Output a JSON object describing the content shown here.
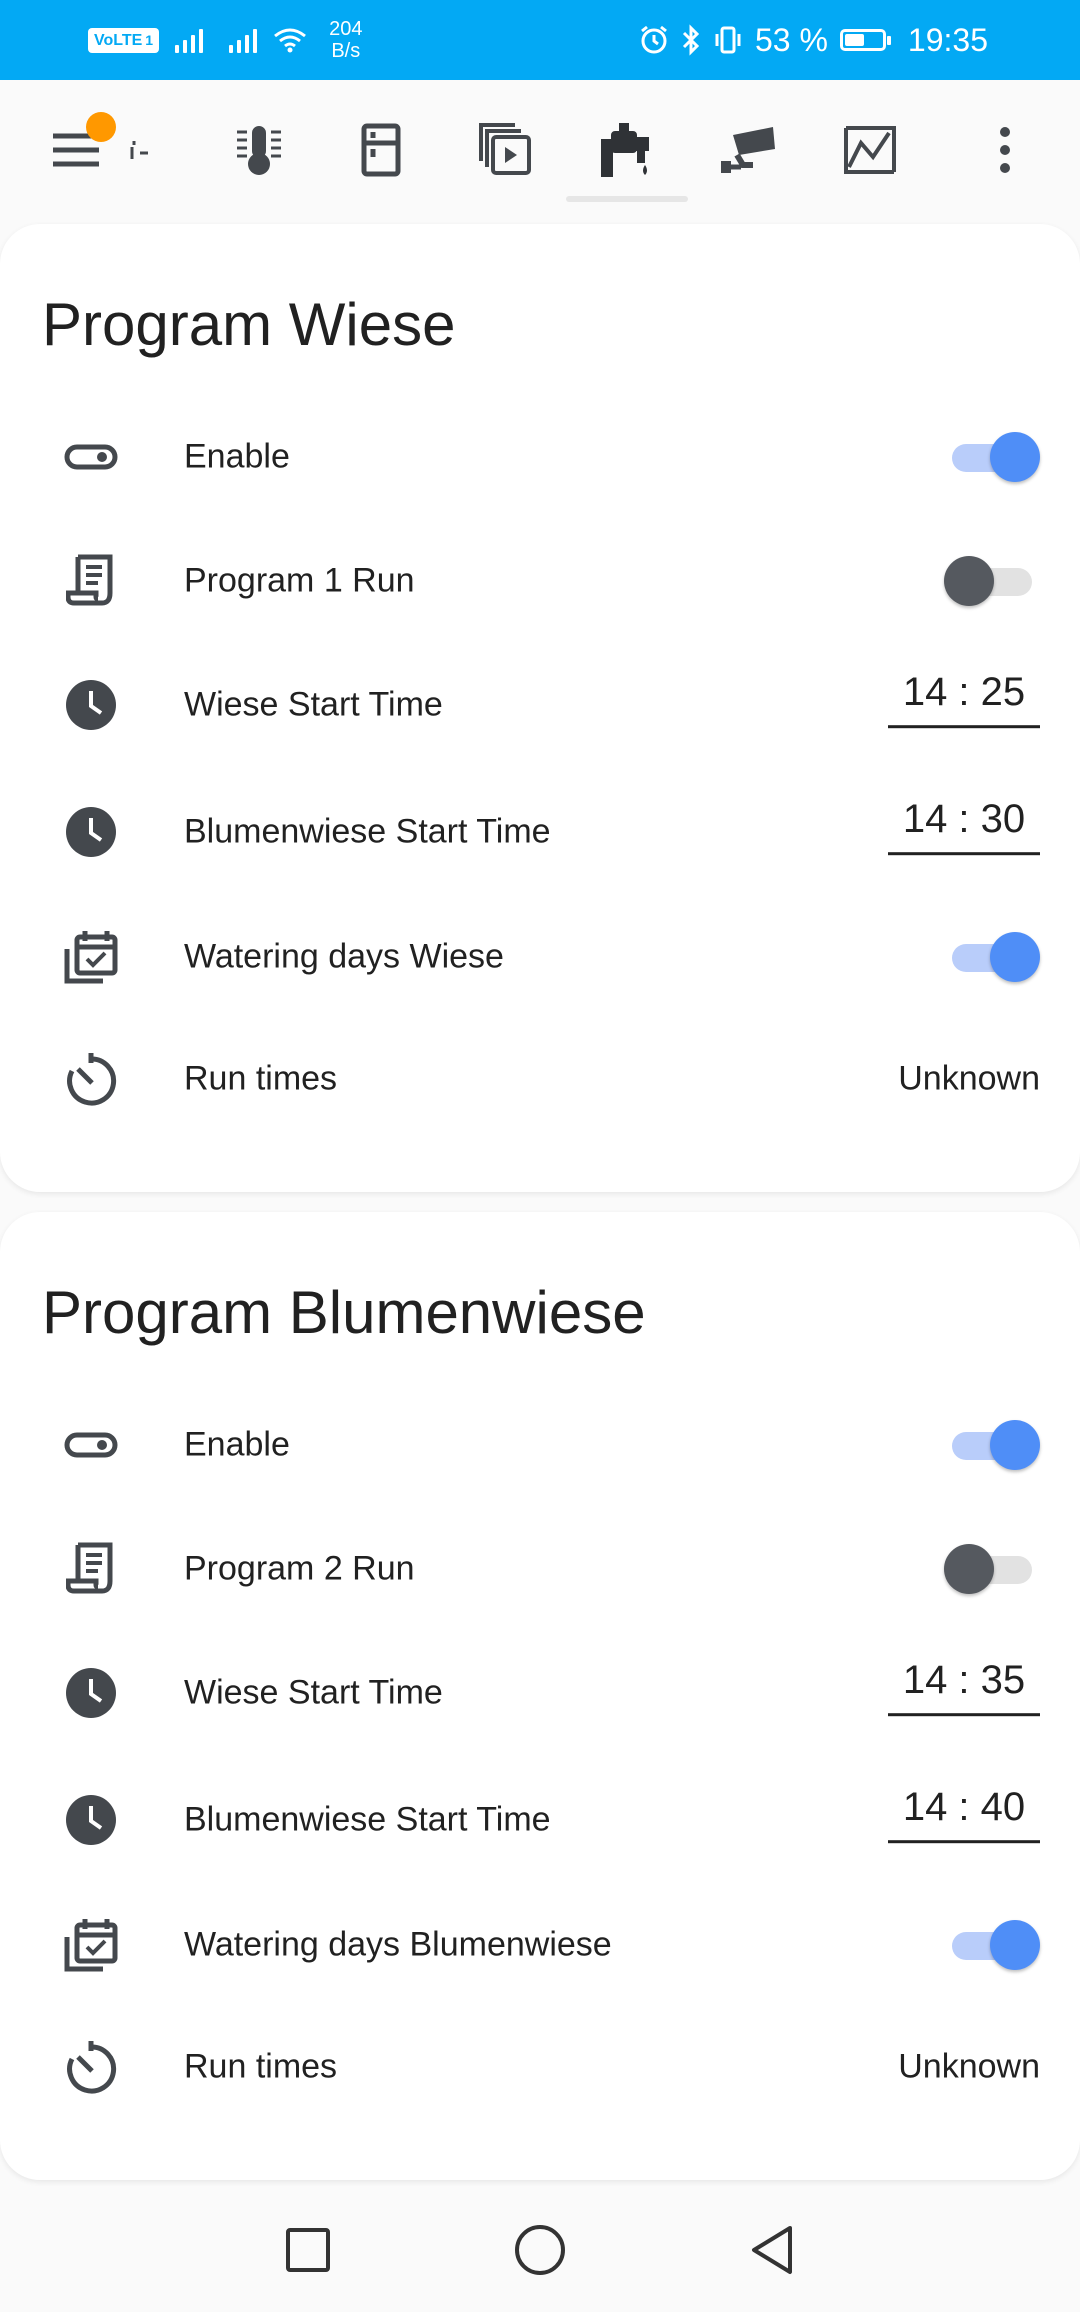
{
  "status_bar": {
    "carrier_badge": "VoLTE",
    "carrier_sub": "1",
    "speed_value": "204",
    "speed_unit": "B/s",
    "battery_percent": "53 %",
    "battery_level": 0.53,
    "time": "19:35",
    "background_color": "#03a9f4"
  },
  "toolbar": {
    "items": [
      {
        "icon": "menu-icon"
      },
      {
        "icon": "scroll-left-indicator-icon"
      },
      {
        "icon": "thermometer-icon"
      },
      {
        "icon": "fridge-icon"
      },
      {
        "icon": "media-library-icon"
      },
      {
        "icon": "water-tap-icon",
        "active": true
      },
      {
        "icon": "cctv-camera-icon"
      },
      {
        "icon": "chart-icon"
      },
      {
        "icon": "more-vert-icon"
      }
    ],
    "badge_color": "#ff9800"
  },
  "cards": [
    {
      "title": "Program Wiese",
      "rows": [
        {
          "icon": "toggle-switch-icon",
          "label": "Enable",
          "control": "toggle",
          "state": true
        },
        {
          "icon": "script-text-icon",
          "label": "Program 1 Run",
          "control": "toggle",
          "state": false
        },
        {
          "icon": "clock-icon",
          "label": "Wiese Start Time",
          "control": "time",
          "value": "14 : 25"
        },
        {
          "icon": "clock-icon",
          "label": "Blumenwiese Start Time",
          "control": "time",
          "value": "14 : 30"
        },
        {
          "icon": "calendar-check-icon",
          "label": "Watering days Wiese",
          "control": "toggle",
          "state": true
        },
        {
          "icon": "timer-icon",
          "label": "Run times",
          "control": "text",
          "value": "Unknown"
        }
      ]
    },
    {
      "title": "Program Blumenwiese",
      "rows": [
        {
          "icon": "toggle-switch-icon",
          "label": "Enable",
          "control": "toggle",
          "state": true
        },
        {
          "icon": "script-text-icon",
          "label": "Program 2 Run",
          "control": "toggle",
          "state": false
        },
        {
          "icon": "clock-icon",
          "label": "Wiese Start Time",
          "control": "time",
          "value": "14 : 35"
        },
        {
          "icon": "clock-icon",
          "label": "Blumenwiese Start Time",
          "control": "time",
          "value": "14 : 40"
        },
        {
          "icon": "calendar-check-icon",
          "label": "Watering days Blumenwiese",
          "control": "toggle",
          "state": true
        },
        {
          "icon": "timer-icon",
          "label": "Run times",
          "control": "text",
          "value": "Unknown"
        }
      ]
    }
  ],
  "nav_bar": {
    "buttons": [
      {
        "icon": "recents-square-icon"
      },
      {
        "icon": "home-circle-icon"
      },
      {
        "icon": "back-triangle-icon"
      }
    ]
  },
  "colors": {
    "toggle_on": "#4f8ef7",
    "toggle_off": "#55595f",
    "icon_gray": "#44484d"
  }
}
